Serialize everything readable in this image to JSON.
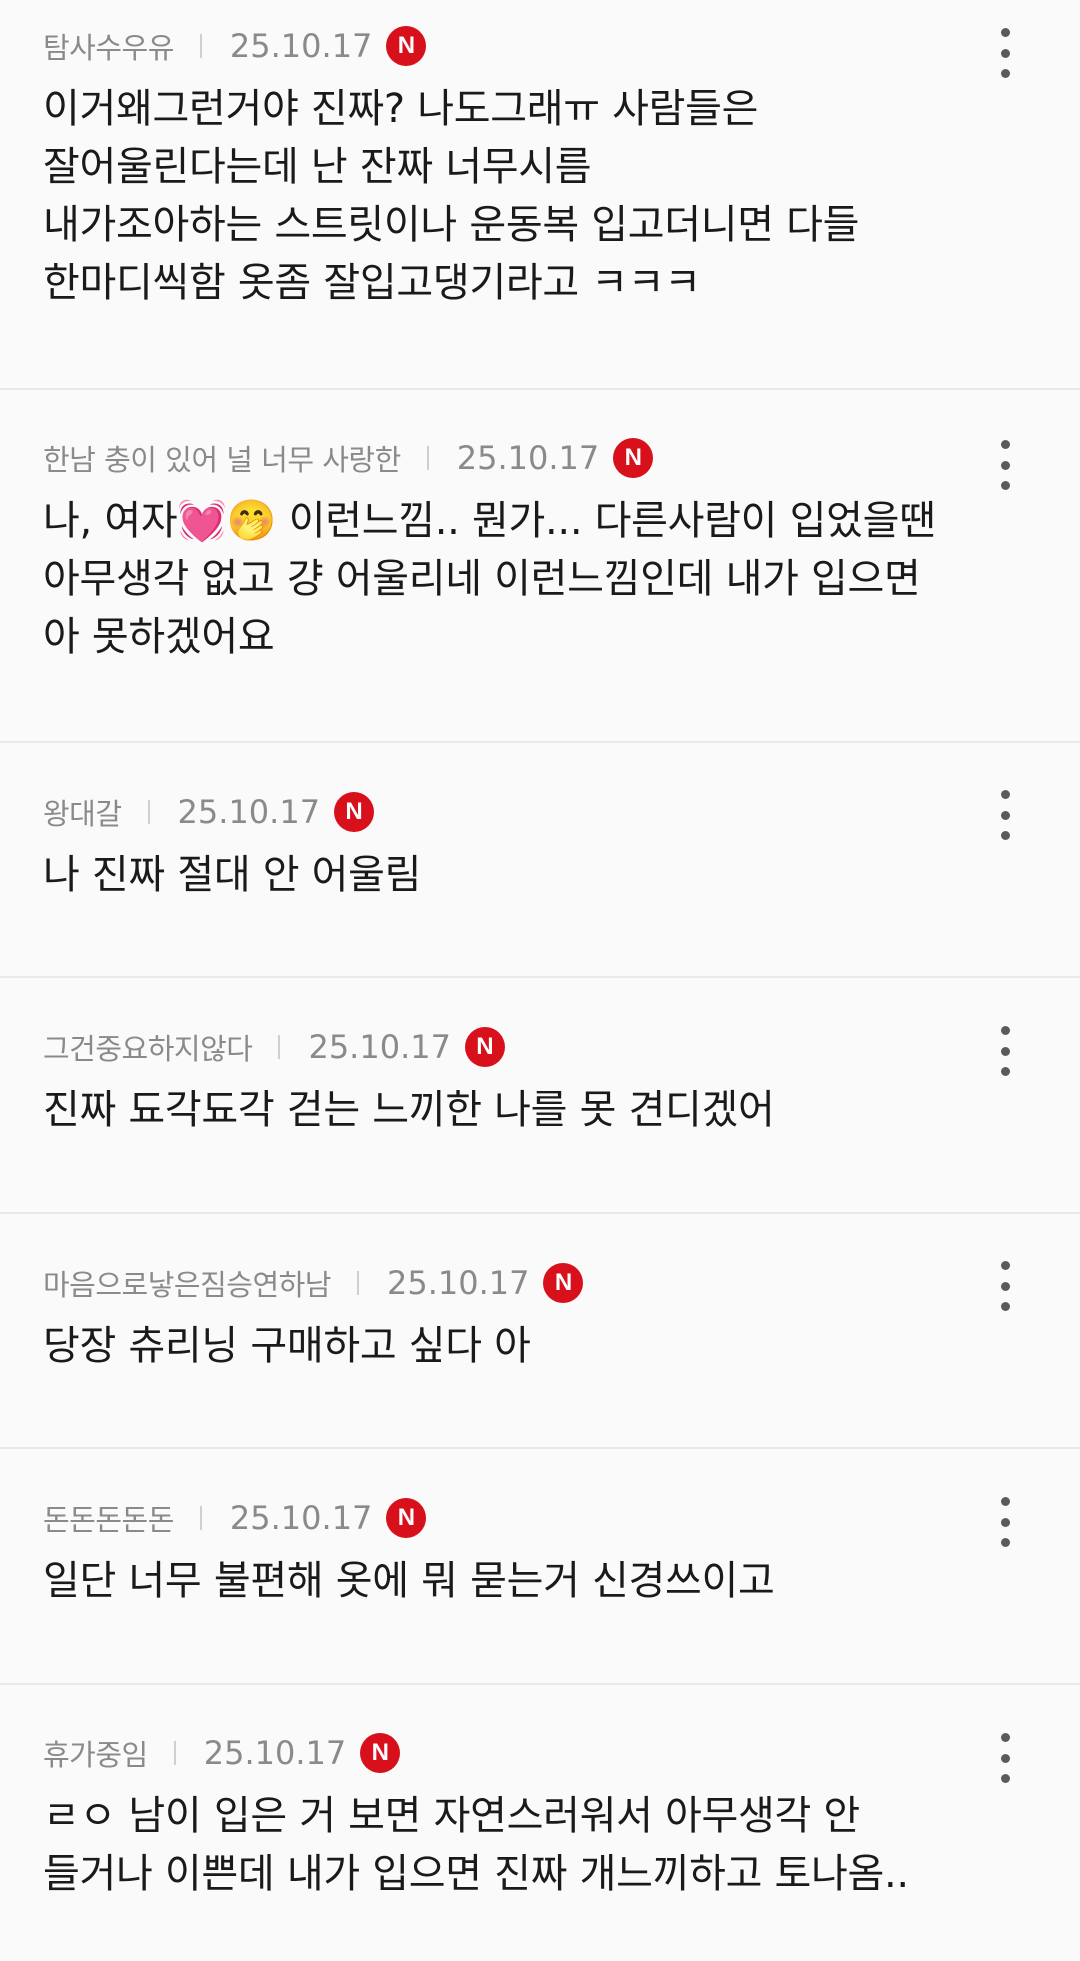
{
  "colors": {
    "background": "#fafafa",
    "meta_text": "#8a8a8a",
    "comment_text": "#1a1a1a",
    "badge": "#d7101b",
    "divider": "#e9e9e9"
  },
  "icons": {
    "badge": "naver-n-badge-icon",
    "more": "more-vertical-icon"
  },
  "badge_label": "N",
  "comments": [
    {
      "nickname": "탐사수우유",
      "date": "25.10.17",
      "text": "이거왜그런거야 진짜? 나도그래ㅠ 사람들은 잘어울린다는데 난 잔짜 너무시름\n내가조아하는 스트릿이나 운동복 입고더니면 다들 한마디씩함 옷좀 잘입고댕기라고 ㅋㅋㅋ"
    },
    {
      "nickname": "한남 충이 있어 널 너무 사랑한",
      "date": "25.10.17",
      "text": "나, 여자💓🤭 이런느낌.. 뭔가... 다른사람이 입었을땐 아무생각 없고 걍 어울리네 이런느낌인데 내가 입으면 아 못하겠어요"
    },
    {
      "nickname": "왕대갈",
      "date": "25.10.17",
      "text": "나 진짜 절대 안 어울림"
    },
    {
      "nickname": "그건중요하지않다",
      "date": "25.10.17",
      "text": "진짜 됴각됴각 걷는 느끼한 나를 못 견디겠어"
    },
    {
      "nickname": "마음으로낳은짐승연하남",
      "date": "25.10.17",
      "text": "당장 츄리닝 구매하고 싶다 아"
    },
    {
      "nickname": "돈돈돈돈돈",
      "date": "25.10.17",
      "text": "일단 너무 불편해 옷에 뭐 묻는거 신경쓰이고"
    },
    {
      "nickname": "휴가중임",
      "date": "25.10.17",
      "text": "ㄹㅇ 남이 입은 거 보면 자연스러워서 아무생각 안 들거나 이쁜데 내가 입으면 진짜 개느끼하고 토나옴.."
    }
  ]
}
